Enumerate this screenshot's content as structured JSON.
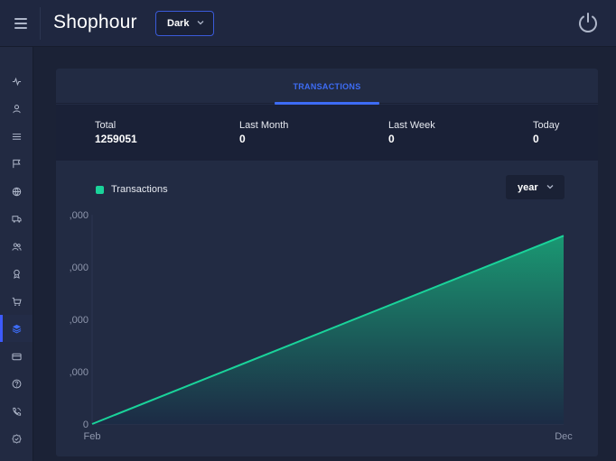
{
  "header": {
    "brand": "Shophour",
    "theme_select": "Dark"
  },
  "sidebar": {
    "items": [
      {
        "icon": "activity-icon"
      },
      {
        "icon": "user-icon"
      },
      {
        "icon": "list-icon"
      },
      {
        "icon": "flag-icon"
      },
      {
        "icon": "globe-icon"
      },
      {
        "icon": "truck-icon"
      },
      {
        "icon": "users-icon"
      },
      {
        "icon": "award-icon"
      },
      {
        "icon": "cart-icon"
      },
      {
        "icon": "layers-icon",
        "active": true
      },
      {
        "icon": "credit-card-icon"
      },
      {
        "icon": "help-icon"
      },
      {
        "icon": "phone-icon"
      },
      {
        "icon": "badge-icon"
      }
    ]
  },
  "main": {
    "tab": "TRANSACTIONS",
    "stats": [
      {
        "label": "Total",
        "value": "1259051"
      },
      {
        "label": "Last Month",
        "value": "0"
      },
      {
        "label": "Last Week",
        "value": "0"
      },
      {
        "label": "Today",
        "value": "0"
      }
    ],
    "period_select": "year"
  },
  "chart_data": {
    "type": "area",
    "x": [
      "Feb",
      "Dec"
    ],
    "series": [
      {
        "name": "Transactions",
        "values": [
          0,
          1259051
        ],
        "color": "#1ad39a"
      }
    ],
    "y_tick_labels": [
      ",000",
      ",000",
      ",000",
      ",000",
      "0"
    ],
    "ylim": [
      0,
      1400000
    ],
    "grid": false,
    "legend": "top-left"
  },
  "colors": {
    "accent": "#3d6cf5",
    "series": "#1ad39a",
    "background": "#1b2236"
  }
}
